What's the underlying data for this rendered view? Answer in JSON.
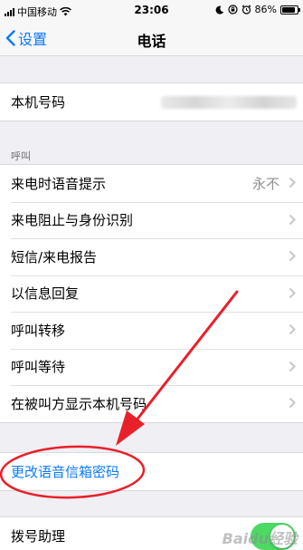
{
  "status_bar": {
    "carrier": "中国移动",
    "time": "23:06",
    "battery": "86%",
    "battery_level": 0.86,
    "icons": [
      "signal-icon",
      "wifi-icon",
      "moon-icon",
      "lock-rotation-icon",
      "alarm-icon",
      "battery-icon"
    ]
  },
  "nav": {
    "back_label": "设置",
    "title": "电话"
  },
  "phone_number": {
    "label": "本机号码"
  },
  "calls": {
    "header": "呼叫",
    "items": [
      {
        "label": "来电时语音提示",
        "value": "永不"
      },
      {
        "label": "来电阻止与身份识别"
      },
      {
        "label": "短信/来电报告"
      },
      {
        "label": "以信息回复"
      },
      {
        "label": "呼叫转移"
      },
      {
        "label": "呼叫等待"
      },
      {
        "label": "在被叫方显示本机号码"
      }
    ]
  },
  "voicemail": {
    "label": "更改语音信箱密码"
  },
  "dial_assist": {
    "label": "拨号助理",
    "enabled": true
  },
  "annotation": {
    "color": "#e8202a"
  },
  "watermark": "Baidu经验",
  "colors": {
    "accent": "#0a7aff",
    "toggle_on": "#4cd964",
    "background": "#efeff4"
  }
}
